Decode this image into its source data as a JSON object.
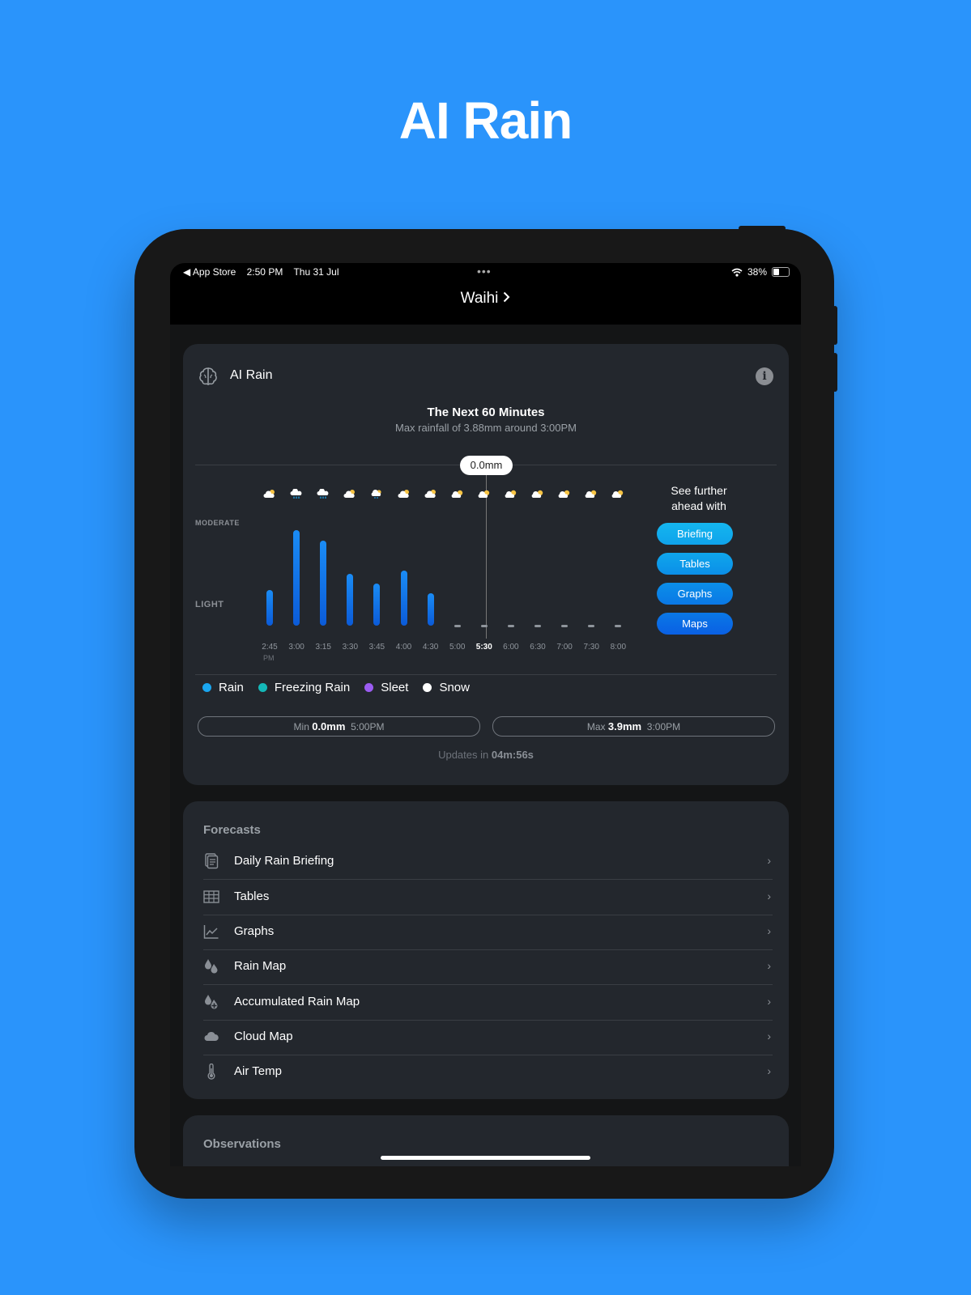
{
  "hero": {
    "title": "AI Rain"
  },
  "status_bar": {
    "back_app": "◀ App Store",
    "time": "2:50 PM",
    "date": "Thu 31 Jul",
    "dots": "•••",
    "battery": "38%",
    "battery_level": 0.38
  },
  "nav": {
    "location": "Waihi"
  },
  "ai_rain_card": {
    "title": "AI Rain",
    "heading": "The Next 60 Minutes",
    "subheading": "Max rainfall of 3.88mm around  3:00PM",
    "tooltip_value": "0.0mm",
    "level_moderate": "MODERATE",
    "level_light": "LIGHT",
    "further_text_1": "See further",
    "further_text_2": "ahead with",
    "buttons": [
      "Briefing",
      "Tables",
      "Graphs",
      "Maps"
    ],
    "legend": [
      {
        "label": "Rain",
        "color": "#1aa6f0"
      },
      {
        "label": "Freezing Rain",
        "color": "#14b8b8"
      },
      {
        "label": "Sleet",
        "color": "#9b5cf2"
      },
      {
        "label": "Snow",
        "color": "#ffffff"
      }
    ],
    "min": {
      "prefix": "Min",
      "value": "0.0mm",
      "time": "5:00PM"
    },
    "max": {
      "prefix": "Max",
      "value": "3.9mm",
      "time": "3:00PM"
    },
    "updates_prefix": "Updates in",
    "updates_countdown": "04m:56s"
  },
  "chart_data": {
    "type": "bar",
    "categories": [
      "2:45",
      "3:00",
      "3:15",
      "3:30",
      "3:45",
      "4:00",
      "4:30",
      "5:00",
      "5:30",
      "6:00",
      "6:30",
      "7:00",
      "7:30",
      "8:00"
    ],
    "first_tick_suffix": "PM",
    "highlighted_category": "5:30",
    "weather_icons": [
      "partly-cloudy",
      "rain",
      "rain",
      "partly-cloudy",
      "rain-light",
      "partly-cloudy",
      "partly-cloudy",
      "partly-sunny",
      "partly-sunny",
      "partly-sunny",
      "partly-sunny",
      "partly-sunny",
      "partly-sunny",
      "partly-sunny"
    ],
    "series": [
      {
        "values": [
          1.45,
          3.88,
          3.45,
          2.1,
          1.7,
          2.25,
          1.3,
          0,
          0,
          0,
          0,
          0,
          0,
          0
        ]
      }
    ],
    "ylim": [
      0,
      4.6
    ],
    "y_levels": [
      "LIGHT",
      "MODERATE"
    ]
  },
  "forecasts": {
    "title": "Forecasts",
    "items": [
      {
        "label": "Daily Rain Briefing",
        "icon": "document-stack-icon"
      },
      {
        "label": "Tables",
        "icon": "table-icon"
      },
      {
        "label": "Graphs",
        "icon": "line-graph-icon"
      },
      {
        "label": "Rain Map",
        "icon": "rain-drops-icon"
      },
      {
        "label": "Accumulated Rain Map",
        "icon": "rain-drops-plus-icon"
      },
      {
        "label": "Cloud Map",
        "icon": "cloud-icon"
      },
      {
        "label": "Air Temp",
        "icon": "thermometer-icon"
      }
    ]
  },
  "observations": {
    "title": "Observations"
  },
  "colors": {
    "background": "#2a94fb",
    "card": "#23272d",
    "bar_top": "#1a8cf5",
    "bar_bottom": "#0b5bd8",
    "button_top": "#12b0ec",
    "button_bottom": "#0b63e6"
  }
}
